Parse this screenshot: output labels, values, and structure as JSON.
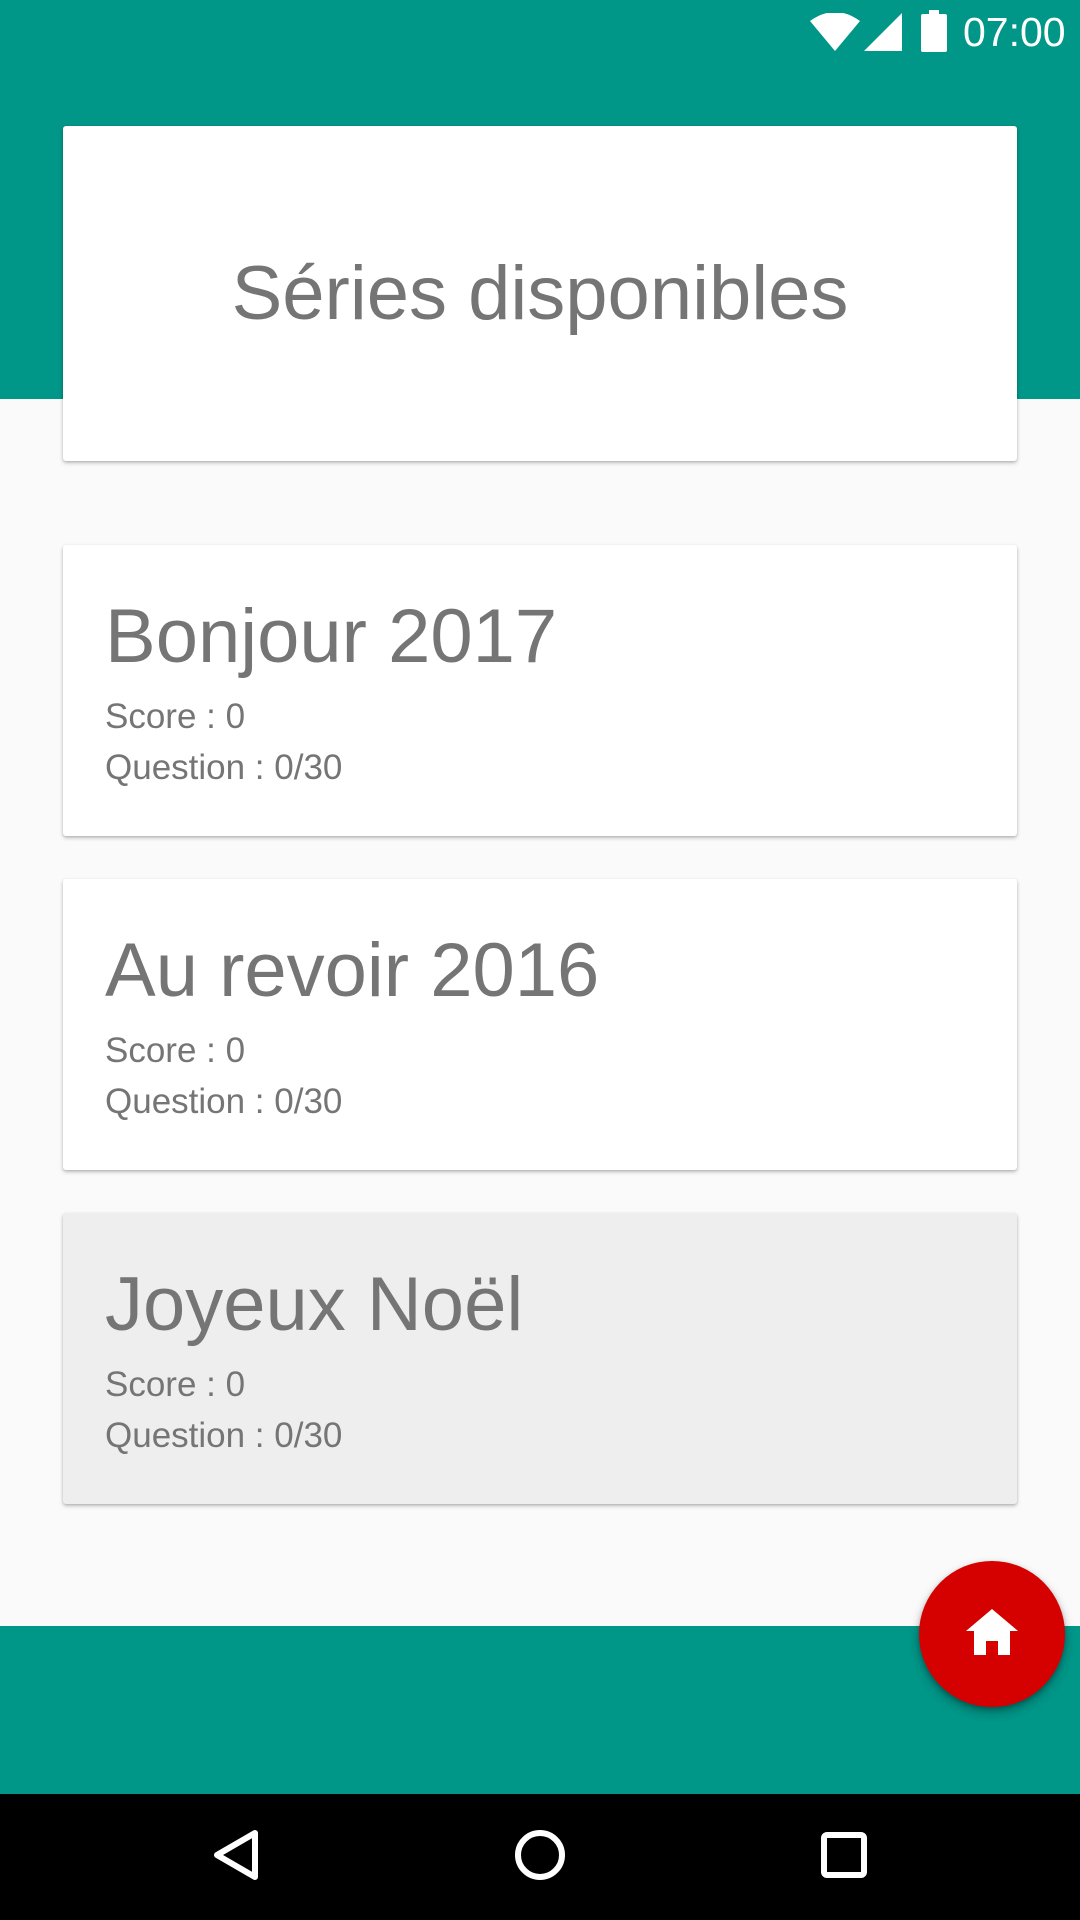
{
  "status_bar": {
    "time": "07:00",
    "icons": [
      "wifi-icon",
      "cell-signal-icon",
      "battery-icon"
    ]
  },
  "header": {
    "title": "Séries disponibles"
  },
  "series": [
    {
      "name": "Bonjour 2017",
      "score": "Score : 0",
      "question": "Question : 0/30"
    },
    {
      "name": "Au revoir 2016",
      "score": "Score : 0",
      "question": "Question : 0/30"
    },
    {
      "name": "Joyeux Noël",
      "score": "Score : 0",
      "question": "Question : 0/30"
    }
  ],
  "fab": {
    "icon": "home-icon",
    "color": "#d50000"
  },
  "nav_bar": {
    "buttons": [
      "back-icon",
      "home-circle-icon",
      "recents-icon"
    ]
  },
  "colors": {
    "primary": "#009688",
    "background": "#fafafa",
    "card": "#ffffff",
    "card_pressed": "#eeeeee",
    "text": "#757575",
    "accent": "#d50000"
  }
}
